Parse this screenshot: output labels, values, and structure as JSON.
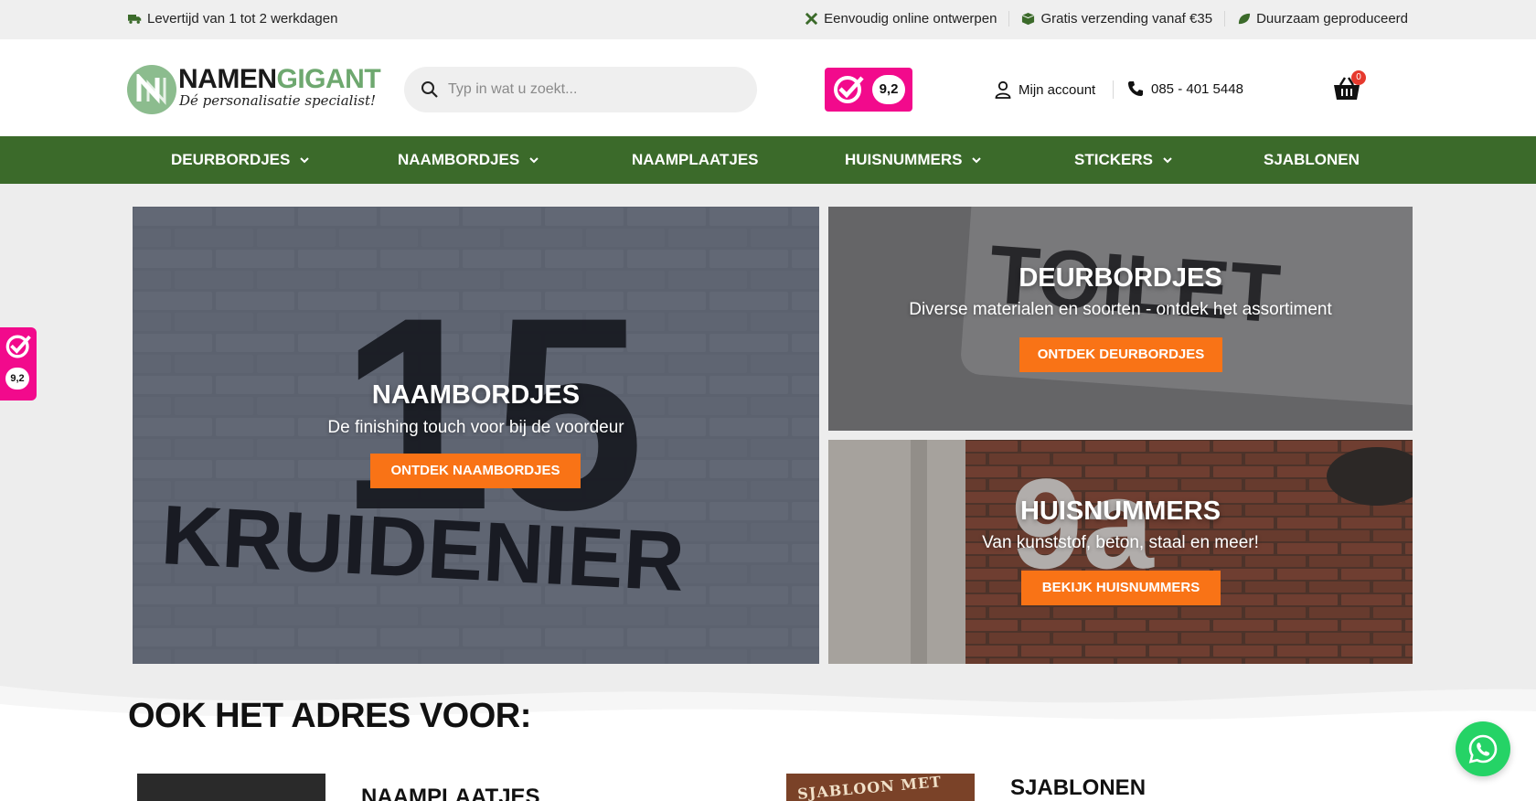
{
  "topbar": {
    "delivery": "Levertijd van 1 tot 2 werkdagen",
    "usps": [
      {
        "icon": "design-tools-icon",
        "label": "Eenvoudig online ontwerpen"
      },
      {
        "icon": "box-icon",
        "label": "Gratis verzending vanaf €35"
      },
      {
        "icon": "leaf-icon",
        "label": "Duurzaam geproduceerd"
      }
    ]
  },
  "header": {
    "logo": {
      "brand_part1": "NAMEN",
      "brand_part2": "GIGANT",
      "tagline": "Dé personalisatie specialist!"
    },
    "search": {
      "placeholder": "Typ in wat u zoekt..."
    },
    "rating": {
      "score": "9,2"
    },
    "account_label": "Mijn account",
    "phone": "085 - 401 5448",
    "cart_count": "0"
  },
  "nav": {
    "items": [
      {
        "label": "DEURBORDJES",
        "has_dropdown": true
      },
      {
        "label": "NAAMBORDJES",
        "has_dropdown": true
      },
      {
        "label": "NAAMPLAATJES",
        "has_dropdown": false
      },
      {
        "label": "HUISNUMMERS",
        "has_dropdown": true
      },
      {
        "label": "STICKERS",
        "has_dropdown": true
      },
      {
        "label": "SJABLONEN",
        "has_dropdown": false
      }
    ]
  },
  "hero": {
    "big": {
      "title": "NAAMBORDJES",
      "subtitle": "De finishing touch voor bij de voordeur",
      "cta": "ONTDEK NAAMBORDJES",
      "image_number": "15",
      "image_word": "KRUIDENIER"
    },
    "top": {
      "title": "DEURBORDJES",
      "subtitle": "Diverse materialen en soorten - ontdek het assortiment",
      "cta": "ONTDEK DEURBORDJES",
      "image_word": "TOILET"
    },
    "bottom": {
      "title": "HUISNUMMERS",
      "subtitle": "Van kunststof, beton, staal en meer!",
      "cta": "BEKIJK HUISNUMMERS",
      "image_number": "9a"
    }
  },
  "section": {
    "title": "OOK HET ADRES VOOR:",
    "categories": [
      {
        "label": "NAAMPLAATJES"
      },
      {
        "label": "SJABLONEN",
        "thumb_text": "SJABLOON MET"
      }
    ]
  },
  "side_rating": {
    "score": "9,2"
  },
  "colors": {
    "nav_green": "#3b6a2a",
    "cta_orange": "#f97316",
    "rating_pink": "#f20a8c",
    "whatsapp_green": "#25d366"
  }
}
